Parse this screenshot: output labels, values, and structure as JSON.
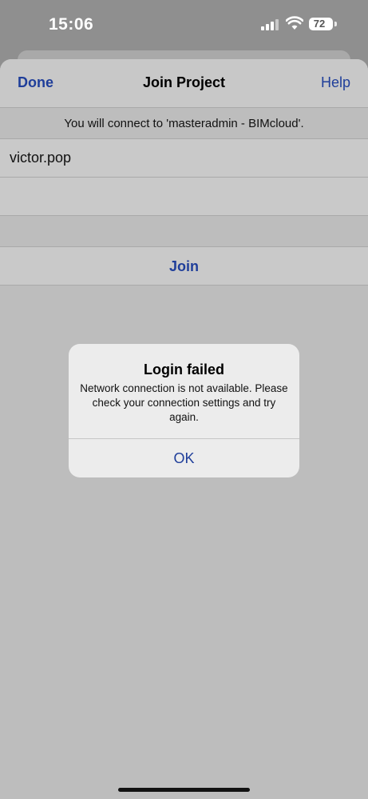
{
  "status_bar": {
    "time": "15:06",
    "battery_level": "72",
    "icons": [
      "signal-icon",
      "wifi-icon",
      "battery-icon"
    ]
  },
  "navbar": {
    "done_label": "Done",
    "title": "Join Project",
    "help_label": "Help"
  },
  "form": {
    "info_text": "You will connect to 'masteradmin - BIMcloud'.",
    "username_value": "victor.pop",
    "password_value": "",
    "join_label": "Join"
  },
  "alert": {
    "title": "Login failed",
    "message": "Network connection is not available. Please check your connection settings and try again.",
    "ok_label": "OK"
  },
  "colors": {
    "accent": "#1f3e9a",
    "sheet_background": "#bdbdbd",
    "alert_background": "#ececec"
  }
}
